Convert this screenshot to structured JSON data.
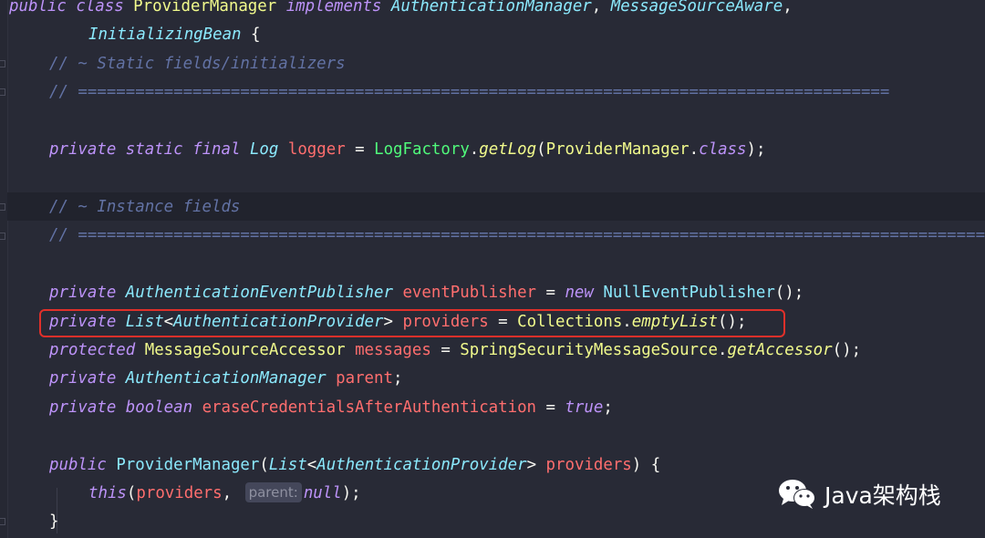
{
  "code": {
    "line1": {
      "public": "public",
      "class": "class",
      "name": "ProviderManager",
      "implements": "implements",
      "iface1": "AuthenticationManager",
      "comma1": ", ",
      "iface2": "MessageSourceAware",
      "comma2": ","
    },
    "line2": {
      "iface3": "InitializingBean",
      "brace": " {"
    },
    "line3": {
      "comment": "// ~ Static fields/initializers"
    },
    "line4": {
      "comment": "// ====================================================================================="
    },
    "line6": {
      "private": "private",
      "static": "static",
      "final": "final",
      "type": "Log",
      "field": "logger",
      "eq": " = ",
      "cls": "LogFactory",
      "dot": ".",
      "method": "getLog",
      "open": "(",
      "arg": "ProviderManager",
      "dot2": ".",
      "classkw": "class",
      "close": ");"
    },
    "line8": {
      "comment": "// ~ Instance fields"
    },
    "line9": {
      "comment": "// ===================================================================================================="
    },
    "line11": {
      "private": "private",
      "type": "AuthenticationEventPublisher",
      "field": "eventPublisher",
      "eq": " = ",
      "new": "new",
      "cls": "NullEventPublisher",
      "close": "();"
    },
    "line12": {
      "private": "private",
      "type": "List",
      "lt": "<",
      "generic": "AuthenticationProvider",
      "gt": ">",
      "field": "providers",
      "eq": " = ",
      "cls": "Collections",
      "dot": ".",
      "method": "emptyList",
      "close": "();"
    },
    "line13": {
      "protected": "protected",
      "type": "MessageSourceAccessor",
      "field": "messages",
      "eq": " = ",
      "cls": "SpringSecurityMessageSource",
      "dot": ".",
      "method": "getAccessor",
      "close": "();"
    },
    "line14": {
      "private": "private",
      "type": "AuthenticationManager",
      "field": "parent",
      "semi": ";"
    },
    "line15": {
      "private": "private",
      "type": "boolean",
      "field": "eraseCredentialsAfterAuthentication",
      "eq": " = ",
      "value": "true",
      "semi": ";"
    },
    "line17": {
      "public": "public",
      "name": "ProviderManager",
      "open": "(",
      "type": "List",
      "lt": "<",
      "generic": "AuthenticationProvider",
      "gt": ">",
      "param": "providers",
      "close": ") {"
    },
    "line18": {
      "this": "this",
      "open": "(",
      "arg": "providers",
      "comma": ",",
      "hint": "parent:",
      "value": "null",
      "close": ");"
    },
    "line19": {
      "brace": "}"
    }
  },
  "watermark": {
    "text": "Java架构栈",
    "icon": "wechat-icon"
  },
  "colors": {
    "background": "#282a36",
    "keyword": "#bd93f9",
    "type": "#8be9fd",
    "class": "#50fa7b",
    "field": "#ff6e6e",
    "method": "#f1fa8c",
    "comment": "#6272a4",
    "highlight": "#e0302a"
  }
}
